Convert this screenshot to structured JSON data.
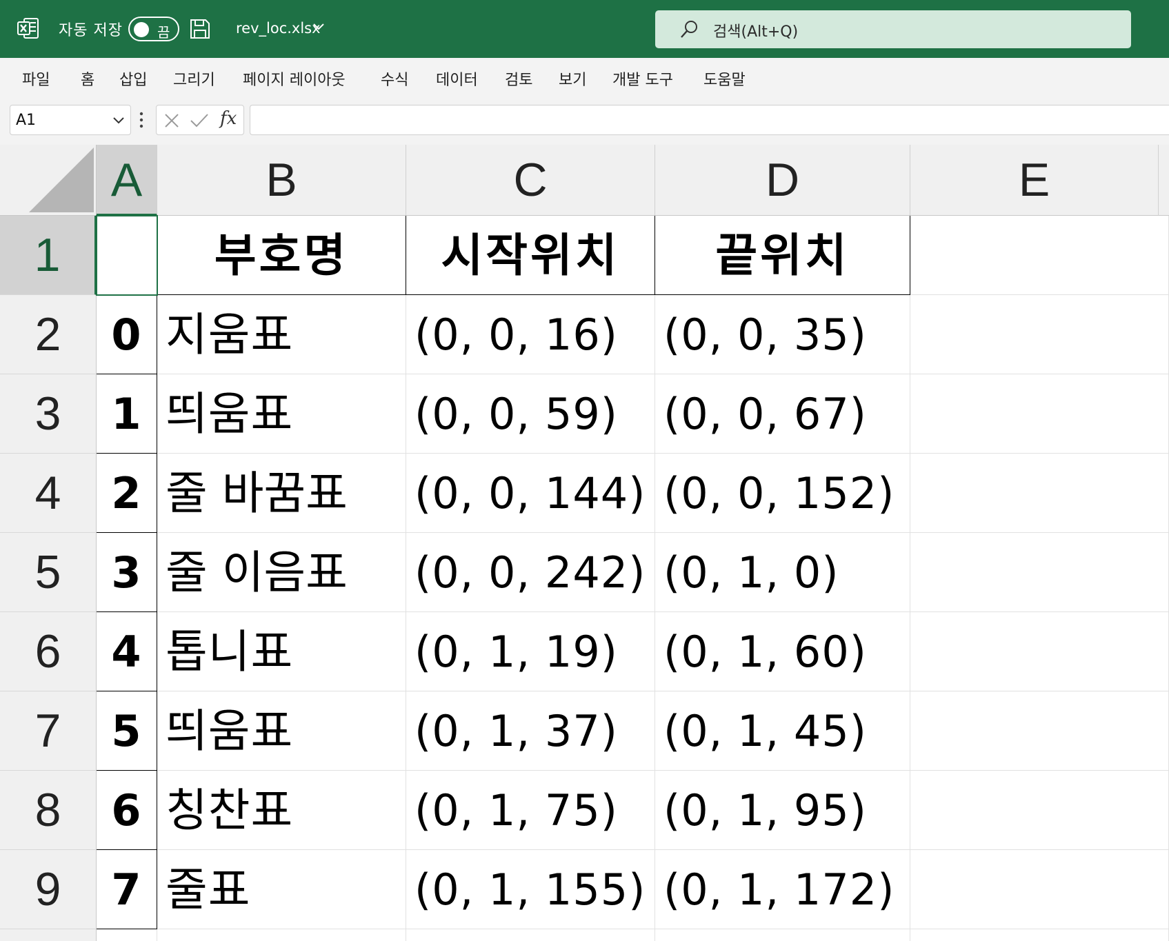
{
  "titlebar": {
    "autosave_label": "자동 저장",
    "toggle_state": "끔",
    "filename": "rev_loc.xlsx",
    "search_placeholder": "검색(Alt+Q)"
  },
  "menu": [
    "파일",
    "홈",
    "삽입",
    "그리기",
    "페이지 레이아웃",
    "수식",
    "데이터",
    "검토",
    "보기",
    "개발 도구",
    "도움말"
  ],
  "formula_bar": {
    "name_box": "A1",
    "fx_label": "fx",
    "formula": ""
  },
  "columns": [
    "A",
    "B",
    "C",
    "D",
    "E"
  ],
  "rows": [
    "1",
    "2",
    "3",
    "4",
    "5",
    "6",
    "7",
    "8",
    "9"
  ],
  "table": {
    "headers": [
      "",
      "부호명",
      "시작위치",
      "끝위치"
    ],
    "rows": [
      [
        "0",
        "지움표",
        "(0, 0, 16)",
        "(0, 0, 35)"
      ],
      [
        "1",
        "띄움표",
        "(0, 0, 59)",
        "(0, 0, 67)"
      ],
      [
        "2",
        "줄 바꿈표",
        "(0, 0, 144)",
        "(0, 0, 152)"
      ],
      [
        "3",
        "줄 이음표",
        "(0, 0, 242)",
        "(0, 1, 0)"
      ],
      [
        "4",
        "톱니표",
        "(0, 1, 19)",
        "(0, 1, 60)"
      ],
      [
        "5",
        "띄움표",
        "(0, 1, 37)",
        "(0, 1, 45)"
      ],
      [
        "6",
        "칭찬표",
        "(0, 1, 75)",
        "(0, 1, 95)"
      ],
      [
        "7",
        "줄표",
        "(0, 1, 155)",
        "(0, 1, 172)"
      ]
    ]
  },
  "colors": {
    "excel_green": "#1e7145",
    "search_bg": "#d3e9dc",
    "header_bg": "#f0f0f0",
    "selected_header_bg": "#d2d2d2"
  }
}
